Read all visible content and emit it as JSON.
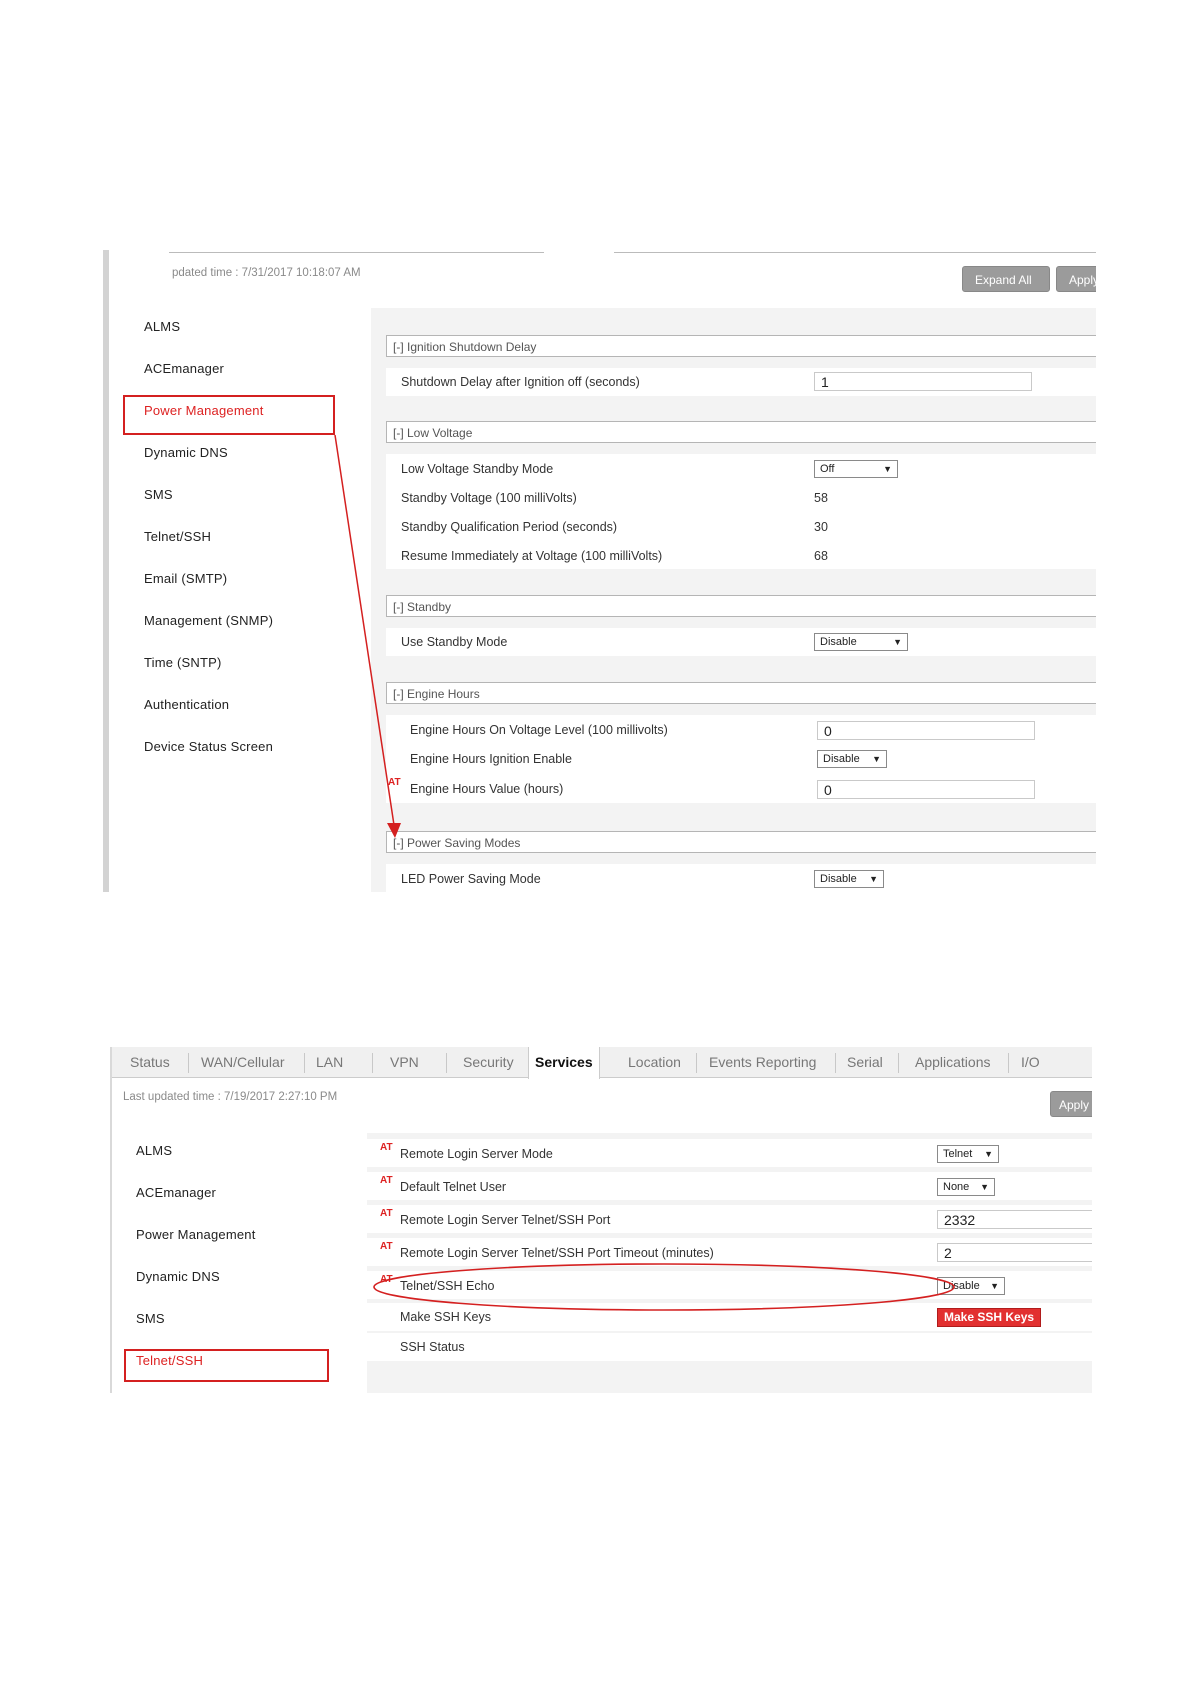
{
  "top_screenshot": {
    "updated_label": "pdated time : 7/31/2017 10:18:07 AM",
    "buttons": {
      "expand_all": "Expand All",
      "apply": "Apply"
    },
    "sidebar": [
      "ALMS",
      "ACEmanager",
      "Power Management",
      "Dynamic DNS",
      "SMS",
      "Telnet/SSH",
      "Email (SMTP)",
      "Management (SNMP)",
      "Time (SNTP)",
      "Authentication",
      "Device Status Screen"
    ],
    "active_item": "Power Management",
    "sections": {
      "ignition": {
        "title": "[-] Ignition Shutdown Delay",
        "shutdown_delay_label": "Shutdown Delay after Ignition off (seconds)",
        "shutdown_delay_value": "1"
      },
      "low_voltage": {
        "title": "[-] Low Voltage",
        "standby_mode_label": "Low Voltage Standby Mode",
        "standby_mode_value": "Off",
        "standby_voltage_label": "Standby Voltage (100 milliVolts)",
        "standby_voltage_value": "58",
        "qualification_label": "Standby Qualification Period (seconds)",
        "qualification_value": "30",
        "resume_label": "Resume Immediately at Voltage (100 milliVolts)",
        "resume_value": "68"
      },
      "standby": {
        "title": "[-] Standby",
        "use_standby_label": "Use Standby Mode",
        "use_standby_value": "Disable"
      },
      "engine_hours": {
        "title": "[-] Engine Hours",
        "voltage_level_label": "Engine Hours On Voltage Level (100 millivolts)",
        "voltage_level_value": "0",
        "ignition_enable_label": "Engine Hours Ignition Enable",
        "ignition_enable_value": "Disable",
        "hours_value_label": "Engine Hours Value (hours)",
        "hours_value_value": "0"
      },
      "power_saving": {
        "title": "[-] Power Saving Modes",
        "led_label": "LED Power Saving Mode",
        "led_value": "Disable"
      }
    }
  },
  "bottom_screenshot": {
    "tabs": [
      "Status",
      "WAN/Cellular",
      "LAN",
      "VPN",
      "Security",
      "Services",
      "Location",
      "Events Reporting",
      "Serial",
      "Applications",
      "I/O"
    ],
    "active_tab": "Services",
    "updated_label": "Last updated time : 7/19/2017 2:27:10 PM",
    "apply": "Apply",
    "sidebar": [
      "ALMS",
      "ACEmanager",
      "Power Management",
      "Dynamic DNS",
      "SMS",
      "Telnet/SSH"
    ],
    "active_item": "Telnet/SSH",
    "at_marker": "AT",
    "rows": {
      "login_mode_label": "Remote Login Server Mode",
      "login_mode_value": "Telnet",
      "telnet_user_label": "Default Telnet User",
      "telnet_user_value": "None",
      "port_label": "Remote Login Server Telnet/SSH Port",
      "port_value": "2332",
      "timeout_label": "Remote Login Server Telnet/SSH Port Timeout (minutes)",
      "timeout_value": "2",
      "echo_label": "Telnet/SSH Echo",
      "echo_value": "Disable",
      "ssh_keys_label": "Make SSH Keys",
      "ssh_keys_button": "Make SSH Keys",
      "ssh_status_label": "SSH Status"
    }
  },
  "colors": {
    "highlight": "#d42020",
    "active_text": "#dd2222",
    "panel_bg": "#f3f3f3",
    "gray_button": "#9b9b9b"
  }
}
